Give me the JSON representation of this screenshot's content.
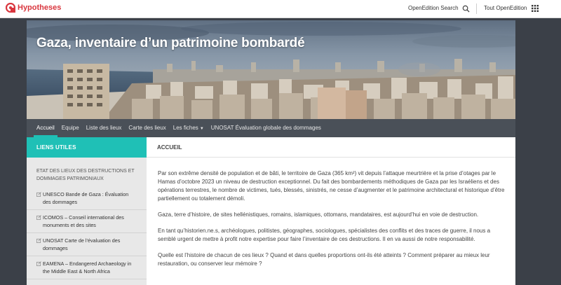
{
  "topbar": {
    "brand": "Hypotheses",
    "search_label": "OpenEdition Search",
    "all_label": "Tout OpenEdition"
  },
  "site": {
    "title": "Gaza, inventaire d’un patrimoine bombardé"
  },
  "nav": {
    "items": [
      {
        "label": "Accueil",
        "active": true
      },
      {
        "label": "Equipe"
      },
      {
        "label": "Liste des lieux"
      },
      {
        "label": "Carte des lieux"
      },
      {
        "label": "Les fiches"
      },
      {
        "label": "UNOSAT Évaluation globale des dommages"
      }
    ]
  },
  "sidebar": {
    "header": "LIENS UTILES",
    "category": "ETAT DES LIEUX DES DESTRUCTIONS ET DOMMAGES PATRIMONIAUX",
    "links": [
      "UNESCO Bande de Gaza : Évaluation des dommages",
      "ICOMOS – Conseil international des monuments et des sites",
      "UNOSAT Carte de l’évaluation des dommages",
      "EAMENA – Endangered Archaeology in the Middle East & North Africa"
    ]
  },
  "main": {
    "header": "ACCUEIL",
    "paragraphs": [
      "Par son extrême densité de population et de bâti, le territoire de Gaza (365 km²) vit depuis l’attaque meurtrière et la prise d’otages par le Hamas d’octobre 2023 un niveau de destruction exceptionnel. Du fait des bombardements méthodiques de Gaza par les Israéliens et des opérations terrestres, le nombre de victimes, tués, blessés, sinistrés, ne cesse d’augmenter et le patrimoine architectural et historique d’être partiellement ou totalement démoli.",
      "Gaza, terre d’histoire, de sites hellénistiques, romains, islamiques, ottomans, mandataires, est aujourd’hui en voie de destruction.",
      "En tant qu’historien.ne.s, archéologues, politistes, géographes, sociologues, spécialistes des conflits et des traces de guerre, il nous a semblé urgent de mettre à profit notre expertise pour faire l’inventaire de ces destructions. Il en va aussi de notre responsabilité.",
      "Quelle est l’histoire de chacun de ces lieux ? Quand et dans quelles proportions ont-ils été atteints ? Comment préparer au mieux leur restauration, ou conserver leur mémoire ?"
    ]
  },
  "colors": {
    "accent": "#1fc0b6",
    "brand": "#d9363e",
    "nav_bg": "#4a5058",
    "page_bg": "#3b4048"
  },
  "icons": {
    "brand": "hypotheses-logo-icon",
    "search": "search-icon",
    "apps": "grid-icon",
    "link": "external-link-icon",
    "dropdown": "chevron-down-icon"
  }
}
